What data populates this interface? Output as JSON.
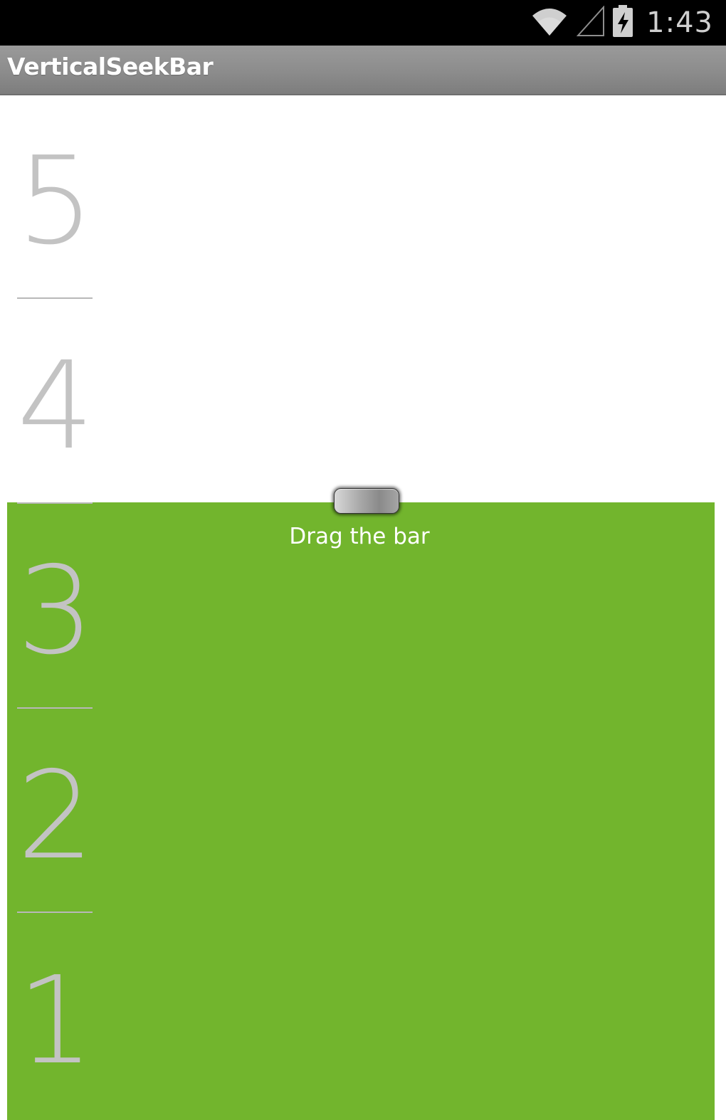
{
  "status_bar": {
    "time": "1:43",
    "icons": [
      "wifi-icon",
      "signal-icon",
      "battery-charging-icon"
    ]
  },
  "action_bar": {
    "title": "VerticalSeekBar"
  },
  "seekbar": {
    "scale_labels": [
      "5",
      "4",
      "3",
      "2",
      "1"
    ],
    "hint": "Drag the bar",
    "fill_color": "#72b52d",
    "level_fraction": 0.61
  }
}
